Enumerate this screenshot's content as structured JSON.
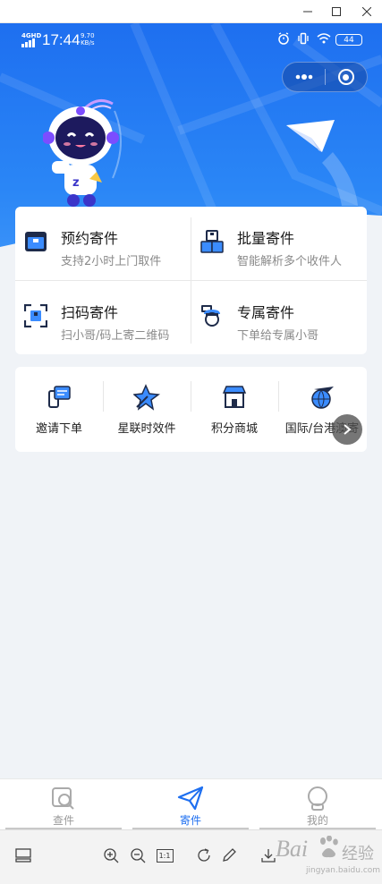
{
  "statusbar": {
    "network": "4GHD",
    "time": "17:44",
    "speed_value": "9.70",
    "speed_unit": "KB/s",
    "battery": "44"
  },
  "colors": {
    "brand_blue": "#1e6ff0",
    "card_bg": "#ffffff",
    "page_bg": "#f0f3f7"
  },
  "services": [
    {
      "title": "预约寄件",
      "subtitle": "支持2小时上门取件",
      "icon": "calendar-box-icon"
    },
    {
      "title": "批量寄件",
      "subtitle": "智能解析多个收件人",
      "icon": "stacked-boxes-icon"
    },
    {
      "title": "扫码寄件",
      "subtitle": "扫小哥/码上寄二维码",
      "icon": "scan-box-icon"
    },
    {
      "title": "专属寄件",
      "subtitle": "下单给专属小哥",
      "icon": "courier-icon"
    }
  ],
  "quick_links": [
    {
      "label": "邀请下单",
      "icon": "invite-phone-icon"
    },
    {
      "label": "星联时效件",
      "icon": "star-arrow-icon"
    },
    {
      "label": "积分商城",
      "icon": "store-icon"
    },
    {
      "label": "国际/台港澳寄",
      "icon": "globe-plane-icon"
    }
  ],
  "tabbar": {
    "tabs": [
      {
        "label": "查件",
        "icon": "search-parcel-icon"
      },
      {
        "label": "寄件",
        "icon": "paper-plane-icon"
      },
      {
        "label": "我的",
        "icon": "user-avatar-icon"
      }
    ]
  },
  "toolbar": {
    "zoom_reset": "1:1"
  },
  "watermark": {
    "main": "Bai",
    "suffix": "经验",
    "url": "jingyan.baidu.com"
  }
}
